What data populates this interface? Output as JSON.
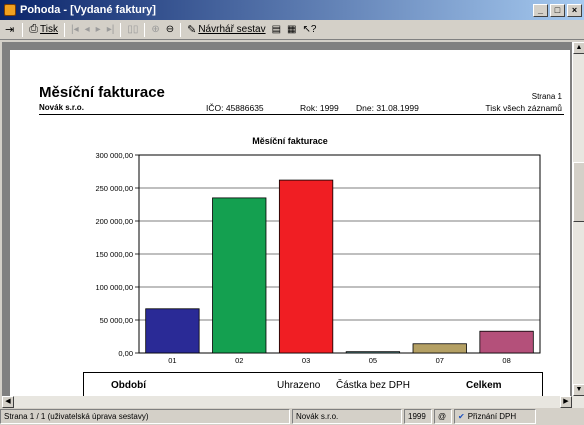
{
  "window": {
    "title": "Pohoda - [Vydané faktury]"
  },
  "toolbar": {
    "print_label": "Tisk",
    "designer_label": "Návrhář sestav"
  },
  "report": {
    "title": "Měsíční fakturace",
    "company": "Novák s.r.o.",
    "ico": "IČO: 45886635",
    "year": "Rok: 1999",
    "date": "Dne: 31.08.1999",
    "page": "Strana 1",
    "print_mode": "Tisk všech záznamů"
  },
  "chart_data": {
    "type": "bar",
    "title": "Měsíční fakturace",
    "categories": [
      "01",
      "02",
      "03",
      "05",
      "07",
      "08"
    ],
    "values": [
      67000,
      235000,
      262000,
      2000,
      14000,
      33000
    ],
    "colors": [
      "#2a2a96",
      "#14a050",
      "#f01e23",
      "#5a8c8c",
      "#b4a064",
      "#b4507a"
    ],
    "ylim": [
      0,
      300000
    ],
    "yticks": [
      0,
      50000,
      100000,
      150000,
      200000,
      250000,
      300000
    ],
    "ytick_labels": [
      "0,00",
      "50 000,00",
      "100 000,00",
      "150 000,00",
      "200 000,00",
      "250 000,00",
      "300 000,00"
    ],
    "grid": true
  },
  "table_header": {
    "period": "Období",
    "paid": "Uhrazeno",
    "amount_ex_vat": "Částka bez DPH",
    "total": "Celkem"
  },
  "status": {
    "page": "Strana 1 / 1  (uživatelská úprava sestavy)",
    "company": "Novák s.r.o.",
    "year": "1999",
    "at": "@",
    "vat": "Přiznání DPH"
  }
}
